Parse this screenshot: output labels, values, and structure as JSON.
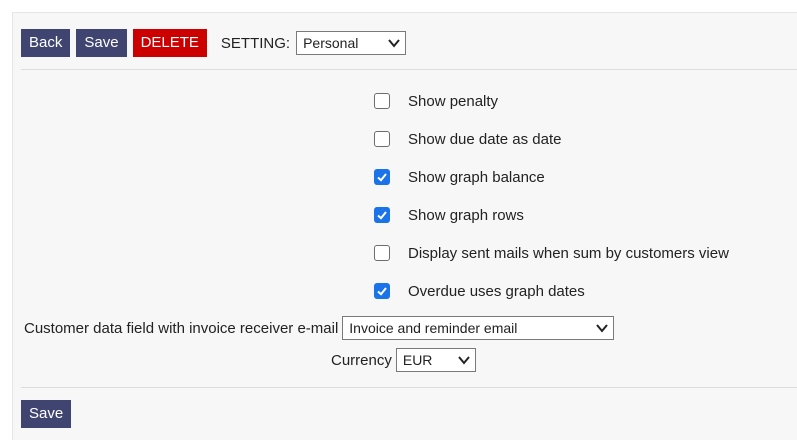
{
  "toolbar": {
    "back_label": "Back",
    "save_label": "Save",
    "delete_label": "DELETE",
    "setting_label": "SETTING:",
    "setting_value": "Personal"
  },
  "options": [
    {
      "label": "Show penalty",
      "checked": false
    },
    {
      "label": "Show due date as date",
      "checked": false
    },
    {
      "label": "Show graph balance",
      "checked": true
    },
    {
      "label": "Show graph rows",
      "checked": true
    },
    {
      "label": "Display sent mails when sum by customers view",
      "checked": false
    },
    {
      "label": "Overdue uses graph dates",
      "checked": true
    }
  ],
  "fields": {
    "email_field_label": "Customer data field with invoice receiver e-mail",
    "email_field_value": "Invoice and reminder email",
    "currency_label": "Currency",
    "currency_value": "EUR"
  },
  "footer": {
    "save_label": "Save"
  },
  "colors": {
    "button_dark": "#3f4570",
    "button_red": "#cc0000",
    "checkbox_checked": "#1a73e8"
  }
}
